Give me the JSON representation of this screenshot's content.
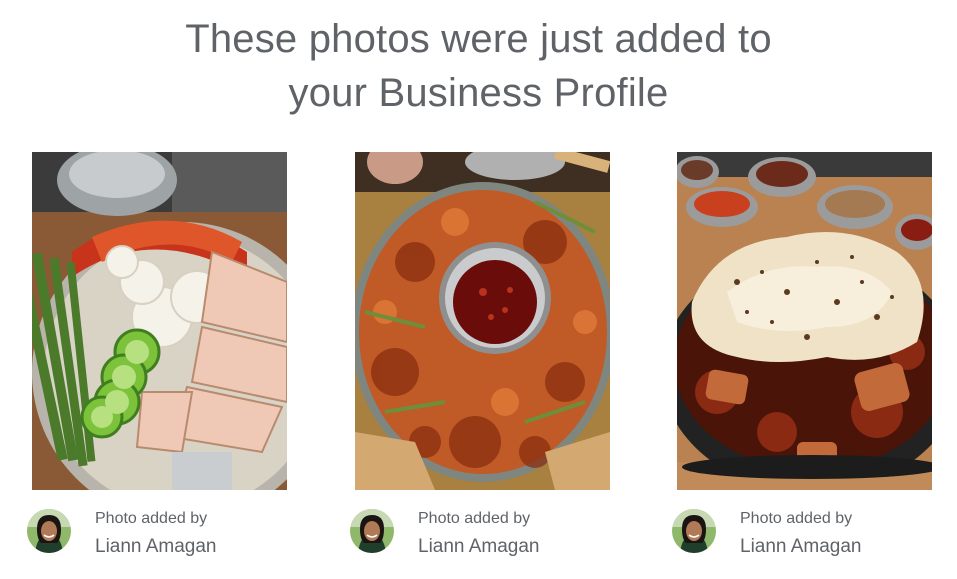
{
  "headline": {
    "line1": "These photos were just added to",
    "line2": "your Business Profile"
  },
  "photos": [
    {
      "icon": "food-photo",
      "added_by_label": "Photo added by",
      "author": "Liann Amagan"
    },
    {
      "icon": "food-photo",
      "added_by_label": "Photo added by",
      "author": "Liann Amagan"
    },
    {
      "icon": "food-photo",
      "added_by_label": "Photo added by",
      "author": "Liann Amagan"
    }
  ],
  "colors": {
    "text": "#5f6368"
  }
}
